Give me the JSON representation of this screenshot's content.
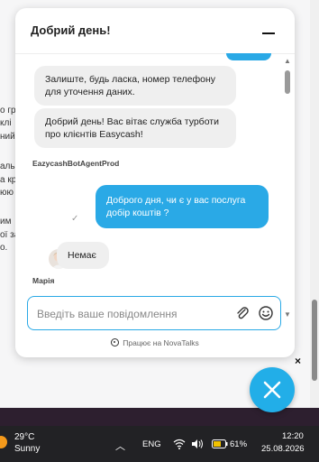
{
  "background_page": {
    "snippets": [
      "о гри",
      "клі",
      "ний",
      "аль",
      "а кр",
      "юю",
      "им",
      "ої за",
      "о."
    ]
  },
  "chat": {
    "title": "Добрий день!",
    "messages": [
      {
        "type": "incoming",
        "text": "Залиште, будь ласка, номер телефону для уточення даних."
      },
      {
        "type": "incoming",
        "text": "Добрий день! Вас вітає служба турботи про клієнтів Easycash!"
      },
      {
        "type": "sender",
        "text": "EazycashBotAgentProd"
      },
      {
        "type": "outgoing",
        "text": "Доброго дня, чи є у вас послуга добір коштів ?"
      },
      {
        "type": "incoming",
        "text": "Немає"
      },
      {
        "type": "sender",
        "text": "Марія"
      }
    ],
    "input": {
      "placeholder": "Введіть ваше повідомлення",
      "value": ""
    },
    "powered_by": "Працює на NovaTalks",
    "accent_color": "#2aa9e6"
  },
  "close_label": "×",
  "taskbar": {
    "temperature": "29°C",
    "weather": "Sunny",
    "language": "ENG",
    "battery": "61%",
    "time": "12:20",
    "date": "25.08.2026"
  }
}
